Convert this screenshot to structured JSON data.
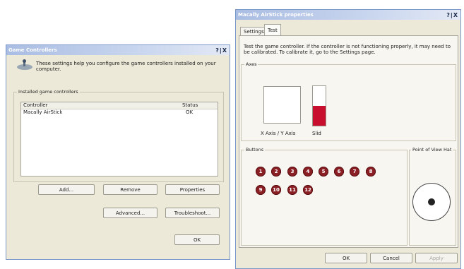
{
  "game_controllers": {
    "title": "Game Controllers",
    "title_buttons": "?|X",
    "intro": "These settings help you configure the game controllers installed on your computer.",
    "installed_label": "Installed game controllers",
    "columns": [
      "Controller",
      "Status"
    ],
    "rows": [
      {
        "controller": "Macally AirStick",
        "status": "OK"
      }
    ],
    "buttons": {
      "add": "Add...",
      "remove": "Remove",
      "properties": "Properties",
      "advanced": "Advanced...",
      "troubleshoot": "Troubleshoot...",
      "ok": "OK"
    }
  },
  "properties": {
    "title": "Macally AirStick properties",
    "title_buttons": "?|X",
    "tabs": [
      "Settings",
      "Test"
    ],
    "active_tab": "Test",
    "description": "Test the game controller.  If the controller is not functioning properly, it may need to be calibrated.  To calibrate it, go to the Settings page.",
    "axes_label": "Axes",
    "axis_caption": "X Axis / Y Axis",
    "axis_value_label": "Slid",
    "slider_level": 0.5,
    "buttons_label": "Buttons",
    "pov_label": "Point of View Hat",
    "button_numbers": [
      "1",
      "2",
      "3",
      "4",
      "5",
      "6",
      "7",
      "8",
      "9",
      "10",
      "11",
      "12"
    ],
    "footer": {
      "ok": "OK",
      "cancel": "Cancel",
      "apply": "Apply"
    }
  },
  "colors": {
    "button_fill": "#8a1f24",
    "slider_fill": "#c8102e",
    "title_gradient": "#a9bde3"
  }
}
